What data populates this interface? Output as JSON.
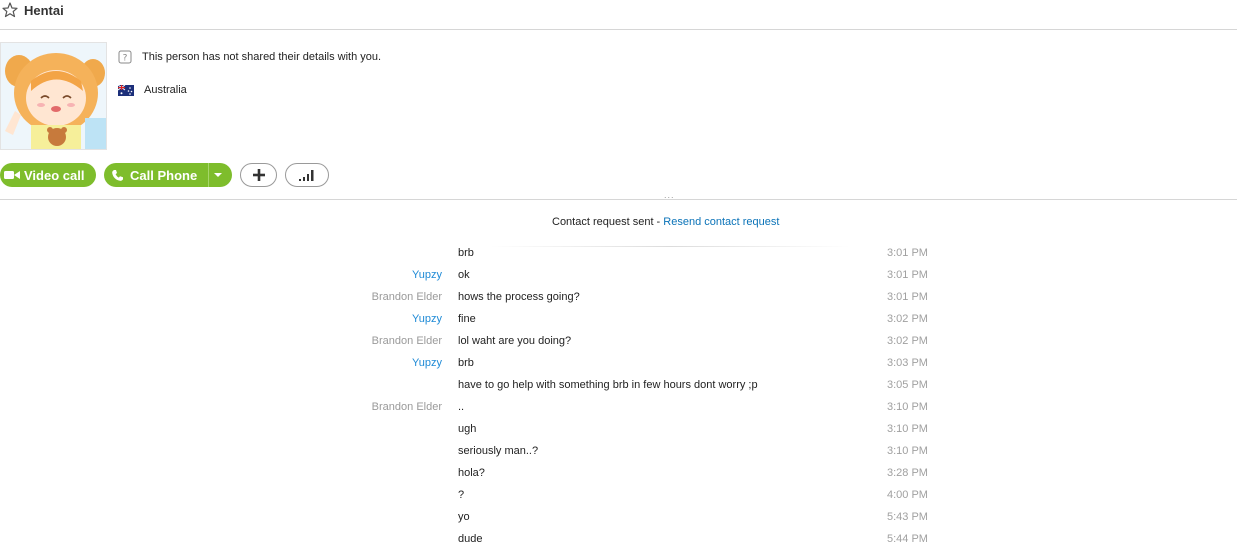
{
  "header": {
    "title": "Hentai",
    "star_icon": "star-outline-icon"
  },
  "profile": {
    "details_text": "This person has not shared their details with you.",
    "country": "Australia",
    "details_icon": "question-card-icon",
    "flag_icon": "australia-flag-icon"
  },
  "actions": {
    "video_call_label": "Video call",
    "call_phone_label": "Call Phone",
    "add_icon": "plus-icon",
    "signal_icon": "signal-bars-icon"
  },
  "chat": {
    "contact_request_text": "Contact request sent - ",
    "resend_link": "Resend contact request",
    "messages": [
      {
        "sender": "",
        "text": "brb",
        "time": "3:01 PM"
      },
      {
        "sender": "Yupzy",
        "text": "ok",
        "time": "3:01 PM"
      },
      {
        "sender": "Brandon Elder",
        "text": "hows the process going?",
        "time": "3:01 PM"
      },
      {
        "sender": "Yupzy",
        "text": "fine",
        "time": "3:02 PM"
      },
      {
        "sender": "Brandon Elder",
        "text": "lol waht are you doing?",
        "time": "3:02 PM"
      },
      {
        "sender": "Yupzy",
        "text": "brb",
        "time": "3:03 PM"
      },
      {
        "sender": "",
        "text": "have to go help with something brb in few hours dont worry ;p",
        "time": "3:05 PM"
      },
      {
        "sender": "Brandon Elder",
        "text": "..",
        "time": "3:10 PM"
      },
      {
        "sender": "",
        "text": "ugh",
        "time": "3:10 PM"
      },
      {
        "sender": "",
        "text": "seriously man..?",
        "time": "3:10 PM"
      },
      {
        "sender": "",
        "text": "hola?",
        "time": "3:28 PM"
      },
      {
        "sender": "",
        "text": "?",
        "time": "4:00 PM"
      },
      {
        "sender": "",
        "text": "yo",
        "time": "5:43 PM"
      },
      {
        "sender": "",
        "text": "dude",
        "time": "5:44 PM"
      }
    ]
  },
  "colors": {
    "accent_green": "#7ebd2c",
    "link_blue": "#0b73b8",
    "self_name_blue": "#1e8ad6",
    "muted_gray": "#9a9a9a"
  }
}
